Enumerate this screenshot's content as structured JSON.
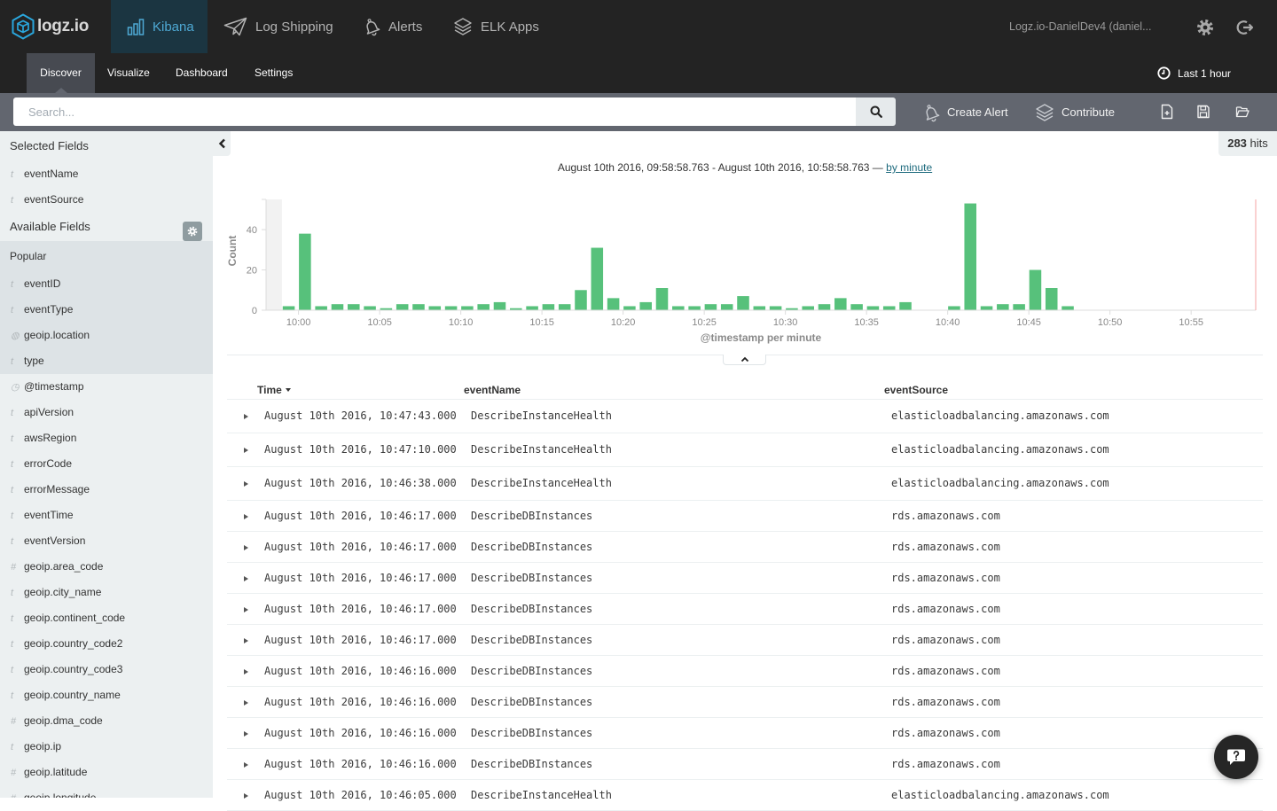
{
  "app": {
    "brand": "logz.io",
    "logo_icon": "logz-logo-icon"
  },
  "top_nav": {
    "items": [
      {
        "label": "Kibana",
        "icon": "bar-chart-icon",
        "active": true
      },
      {
        "label": "Log Shipping",
        "icon": "paper-plane-icon",
        "active": false
      },
      {
        "label": "Alerts",
        "icon": "bell-icon",
        "active": false
      },
      {
        "label": "ELK Apps",
        "icon": "layers-icon",
        "active": false
      }
    ],
    "account": "Logz.io-DanielDev4 (daniel...",
    "settings_icon": "gear-icon",
    "logout_icon": "logout-icon",
    "accent_color": "#4ea9d4"
  },
  "sub_nav": {
    "tabs": [
      {
        "label": "Discover",
        "active": true
      },
      {
        "label": "Visualize",
        "active": false
      },
      {
        "label": "Dashboard",
        "active": false
      },
      {
        "label": "Settings",
        "active": false
      }
    ],
    "time_picker": {
      "icon": "clock-icon",
      "label": "Last 1 hour"
    }
  },
  "search": {
    "placeholder": "Search...",
    "value": "",
    "button_icon": "search-icon"
  },
  "toolbar": {
    "create_alert": {
      "label": "Create Alert",
      "icon": "bell-icon"
    },
    "contribute": {
      "label": "Contribute",
      "icon": "layers-icon"
    },
    "icons": [
      "new-search-icon",
      "save-search-icon",
      "open-search-icon"
    ]
  },
  "sidebar": {
    "selected_header": "Selected Fields",
    "selected": [
      {
        "name": "eventName",
        "glyph": "t",
        "icon": "string-type-icon"
      },
      {
        "name": "eventSource",
        "glyph": "t",
        "icon": "string-type-icon"
      }
    ],
    "available_header": "Available Fields",
    "popular_header": "Popular",
    "popular": [
      {
        "name": "eventID",
        "glyph": "t",
        "icon": "string-type-icon"
      },
      {
        "name": "eventType",
        "glyph": "t",
        "icon": "string-type-icon"
      },
      {
        "name": "geoip.location",
        "glyph": "◍",
        "icon": "geo-point-type-icon"
      },
      {
        "name": "type",
        "glyph": "t",
        "icon": "string-type-icon"
      }
    ],
    "fields": [
      {
        "name": "@timestamp",
        "glyph": "◷",
        "icon": "date-type-icon"
      },
      {
        "name": "apiVersion",
        "glyph": "t",
        "icon": "string-type-icon"
      },
      {
        "name": "awsRegion",
        "glyph": "t",
        "icon": "string-type-icon"
      },
      {
        "name": "errorCode",
        "glyph": "t",
        "icon": "string-type-icon"
      },
      {
        "name": "errorMessage",
        "glyph": "t",
        "icon": "string-type-icon"
      },
      {
        "name": "eventTime",
        "glyph": "t",
        "icon": "string-type-icon"
      },
      {
        "name": "eventVersion",
        "glyph": "t",
        "icon": "string-type-icon"
      },
      {
        "name": "geoip.area_code",
        "glyph": "#",
        "icon": "number-type-icon"
      },
      {
        "name": "geoip.city_name",
        "glyph": "t",
        "icon": "string-type-icon"
      },
      {
        "name": "geoip.continent_code",
        "glyph": "t",
        "icon": "string-type-icon"
      },
      {
        "name": "geoip.country_code2",
        "glyph": "t",
        "icon": "string-type-icon"
      },
      {
        "name": "geoip.country_code3",
        "glyph": "t",
        "icon": "string-type-icon"
      },
      {
        "name": "geoip.country_name",
        "glyph": "t",
        "icon": "string-type-icon"
      },
      {
        "name": "geoip.dma_code",
        "glyph": "#",
        "icon": "number-type-icon"
      },
      {
        "name": "geoip.ip",
        "glyph": "t",
        "icon": "string-type-icon"
      },
      {
        "name": "geoip.latitude",
        "glyph": "#",
        "icon": "number-type-icon"
      },
      {
        "name": "geoip.longitude",
        "glyph": "#",
        "icon": "number-type-icon"
      }
    ]
  },
  "hits": {
    "count": "283",
    "label": "hits"
  },
  "chart_header": {
    "range": "August 10th 2016, 09:58:58.763 - August 10th 2016, 10:58:58.763",
    "separator": "—",
    "interval": "by minute"
  },
  "chart_data": {
    "type": "bar",
    "title": "",
    "xlabel": "@timestamp per minute",
    "ylabel": "Count",
    "ylim": [
      0,
      55
    ],
    "y_ticks": [
      0,
      20,
      40
    ],
    "x_ticks": [
      "10:00",
      "10:05",
      "10:10",
      "10:15",
      "10:20",
      "10:25",
      "10:30",
      "10:35",
      "10:40",
      "10:45",
      "10:50",
      "10:55"
    ],
    "x_range": [
      "09:58:58.763",
      "10:58:58.763"
    ],
    "categories": [
      "09:59",
      "10:00",
      "10:01",
      "10:02",
      "10:03",
      "10:04",
      "10:05",
      "10:06",
      "10:07",
      "10:08",
      "10:09",
      "10:10",
      "10:11",
      "10:12",
      "10:13",
      "10:14",
      "10:15",
      "10:16",
      "10:17",
      "10:18",
      "10:19",
      "10:20",
      "10:21",
      "10:22",
      "10:23",
      "10:24",
      "10:25",
      "10:26",
      "10:27",
      "10:28",
      "10:29",
      "10:30",
      "10:31",
      "10:32",
      "10:33",
      "10:34",
      "10:35",
      "10:36",
      "10:37",
      "10:38",
      "10:39",
      "10:40",
      "10:41",
      "10:42",
      "10:43",
      "10:44",
      "10:45",
      "10:46",
      "10:47"
    ],
    "values": [
      2,
      38,
      2,
      3,
      3,
      2,
      1,
      3,
      3,
      2,
      2,
      2,
      3,
      4,
      1,
      2,
      3,
      3,
      10,
      31,
      6,
      2,
      4,
      11,
      2,
      2,
      3,
      3,
      7,
      2,
      2,
      1,
      2,
      3,
      6,
      3,
      2,
      2,
      4,
      0,
      0,
      2,
      53,
      2,
      3,
      3,
      20,
      11,
      2
    ],
    "color": "#57c17b",
    "end_marker_color": "#f6b2b2",
    "grid": false,
    "legend": "none"
  },
  "table": {
    "columns": [
      "Time",
      "eventName",
      "eventSource"
    ],
    "sort": {
      "column": "Time",
      "direction": "desc",
      "icon": "sort-desc-icon"
    },
    "rows": [
      {
        "time": "August 10th 2016, 10:47:43.000",
        "eventName": "DescribeInstanceHealth",
        "eventSource": "elasticloadbalancing.amazonaws.com"
      },
      {
        "time": "August 10th 2016, 10:47:10.000",
        "eventName": "DescribeInstanceHealth",
        "eventSource": "elasticloadbalancing.amazonaws.com"
      },
      {
        "time": "August 10th 2016, 10:46:38.000",
        "eventName": "DescribeInstanceHealth",
        "eventSource": "elasticloadbalancing.amazonaws.com"
      },
      {
        "time": "August 10th 2016, 10:46:17.000",
        "eventName": "DescribeDBInstances",
        "eventSource": "rds.amazonaws.com"
      },
      {
        "time": "August 10th 2016, 10:46:17.000",
        "eventName": "DescribeDBInstances",
        "eventSource": "rds.amazonaws.com"
      },
      {
        "time": "August 10th 2016, 10:46:17.000",
        "eventName": "DescribeDBInstances",
        "eventSource": "rds.amazonaws.com"
      },
      {
        "time": "August 10th 2016, 10:46:17.000",
        "eventName": "DescribeDBInstances",
        "eventSource": "rds.amazonaws.com"
      },
      {
        "time": "August 10th 2016, 10:46:17.000",
        "eventName": "DescribeDBInstances",
        "eventSource": "rds.amazonaws.com"
      },
      {
        "time": "August 10th 2016, 10:46:16.000",
        "eventName": "DescribeDBInstances",
        "eventSource": "rds.amazonaws.com"
      },
      {
        "time": "August 10th 2016, 10:46:16.000",
        "eventName": "DescribeDBInstances",
        "eventSource": "rds.amazonaws.com"
      },
      {
        "time": "August 10th 2016, 10:46:16.000",
        "eventName": "DescribeDBInstances",
        "eventSource": "rds.amazonaws.com"
      },
      {
        "time": "August 10th 2016, 10:46:16.000",
        "eventName": "DescribeDBInstances",
        "eventSource": "rds.amazonaws.com"
      },
      {
        "time": "August 10th 2016, 10:46:05.000",
        "eventName": "DescribeInstanceHealth",
        "eventSource": "elasticloadbalancing.amazonaws.com"
      }
    ]
  },
  "help": {
    "icon": "help-chat-icon"
  }
}
